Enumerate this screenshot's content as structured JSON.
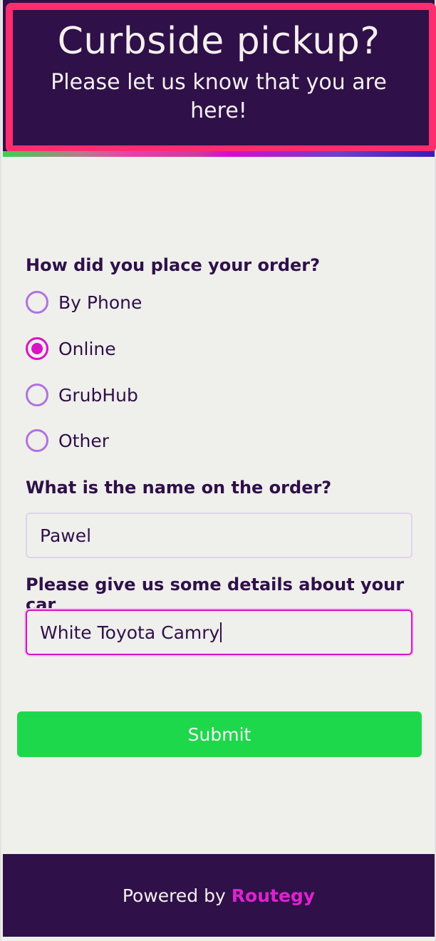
{
  "header": {
    "title": "Curbside pickup?",
    "subtitle": "Please let us know that you are here!"
  },
  "form": {
    "order_method": {
      "question": "How did you place your order?",
      "options": [
        {
          "label": "By Phone",
          "selected": false
        },
        {
          "label": "Online",
          "selected": true
        },
        {
          "label": "GrubHub",
          "selected": false
        },
        {
          "label": "Other",
          "selected": false
        }
      ]
    },
    "name": {
      "question": "What is the name on the order?",
      "value": "Pawel"
    },
    "car": {
      "question": "Please give us some details about your car",
      "value": "White Toyota Camry"
    },
    "submit_label": "Submit"
  },
  "footer": {
    "prefix": "Powered by",
    "brand": "Routegy"
  },
  "colors": {
    "primary_dark": "#2f1049",
    "accent_pink": "#ff2d6f",
    "accent_magenta": "#d814c4",
    "radio_border": "#b073de",
    "submit_green": "#1ed84c",
    "background": "#efefec"
  }
}
